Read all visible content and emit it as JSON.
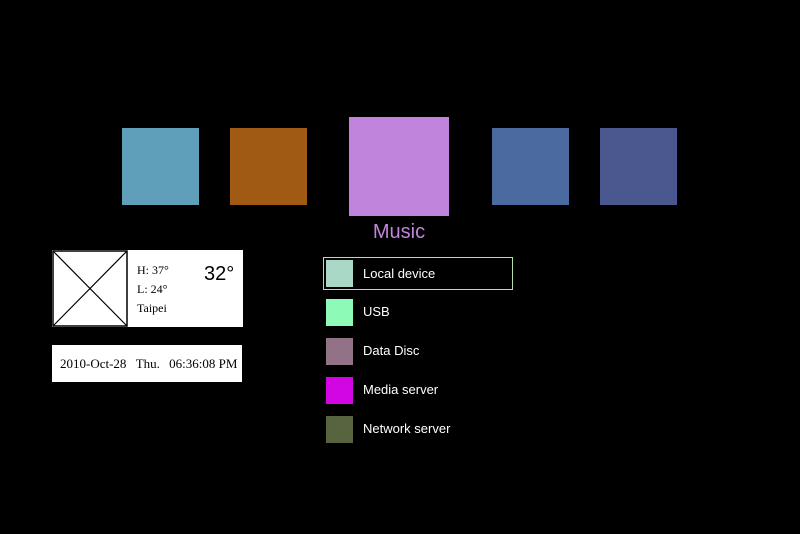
{
  "categories": {
    "items": [
      {
        "color": "#5f9fb9"
      },
      {
        "color": "#a05a14"
      },
      {
        "color": "#c084dc"
      },
      {
        "color": "#4a6aa0"
      },
      {
        "color": "#4b5890"
      }
    ],
    "selected_index": 2,
    "selected_label": "Music",
    "selected_label_color": "#c084dc"
  },
  "weather": {
    "icon": "image-placeholder-icon",
    "high": "H: 37°",
    "low": "L: 24°",
    "city": "Taipei",
    "temperature": "32°"
  },
  "datetime": {
    "date": "2010-Oct-28",
    "day": "Thu.",
    "time": "06:36:08 PM"
  },
  "sources": {
    "selected_index": 0,
    "selected_border_color": "#aee3a8",
    "items": [
      {
        "label": "Local device",
        "color": "#a9d8c6"
      },
      {
        "label": "USB",
        "color": "#8dfab8"
      },
      {
        "label": "Data Disc",
        "color": "#927286"
      },
      {
        "label": "Media server",
        "color": "#d205e3"
      },
      {
        "label": "Network server",
        "color": "#586340"
      }
    ]
  }
}
